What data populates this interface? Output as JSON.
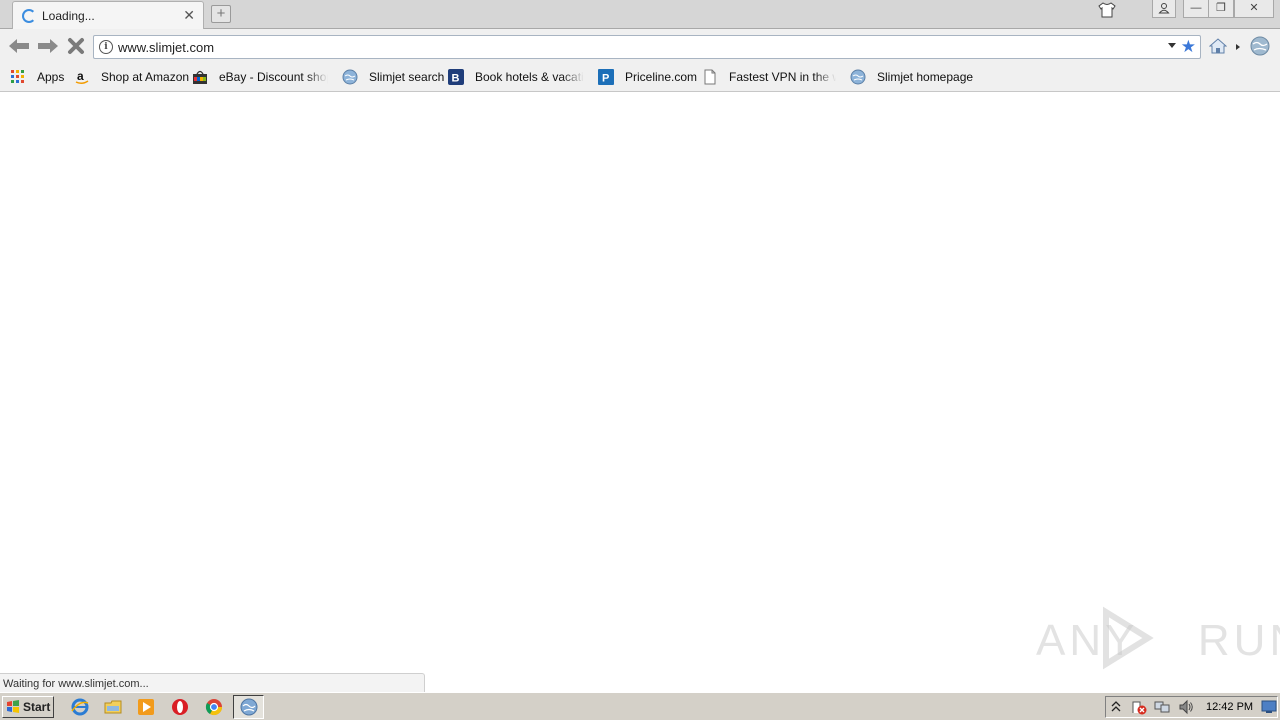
{
  "browser": {
    "tab": {
      "title": "Loading...",
      "close_glyph": "✕",
      "spinner_icon": "loading-spinner-icon"
    },
    "new_tab_glyph": "+",
    "window_controls": {
      "minimize": "—",
      "restore": "❐",
      "close": "✕"
    }
  },
  "toolbar": {
    "address": "www.slimjet.com",
    "icons": [
      "back-arrow-icon",
      "forward-arrow-icon",
      "stop-icon",
      "info-icon",
      "bookmark-star-icon",
      "home-icon",
      "menu-globe-icon"
    ],
    "accent_color": "#3b78d8"
  },
  "bookmarks": [
    {
      "label": "Apps",
      "icon": "apps-grid-icon"
    },
    {
      "label": "Shop at Amazon",
      "icon": "amazon-icon"
    },
    {
      "label": "eBay - Discount shoppi",
      "icon": "ebay-icon"
    },
    {
      "label": "Slimjet search",
      "icon": "globe-icon"
    },
    {
      "label": "Book hotels & vacation",
      "icon": "booking-icon"
    },
    {
      "label": "Priceline.com",
      "icon": "priceline-icon"
    },
    {
      "label": "Fastest VPN in the wor",
      "icon": "page-icon"
    },
    {
      "label": "Slimjet homepage",
      "icon": "globe-icon"
    }
  ],
  "status_bar": {
    "text": "Waiting for www.slimjet.com..."
  },
  "watermark": {
    "text": "ANY RUN"
  },
  "taskbar": {
    "start_label": "Start",
    "clock": "12:42 PM"
  }
}
